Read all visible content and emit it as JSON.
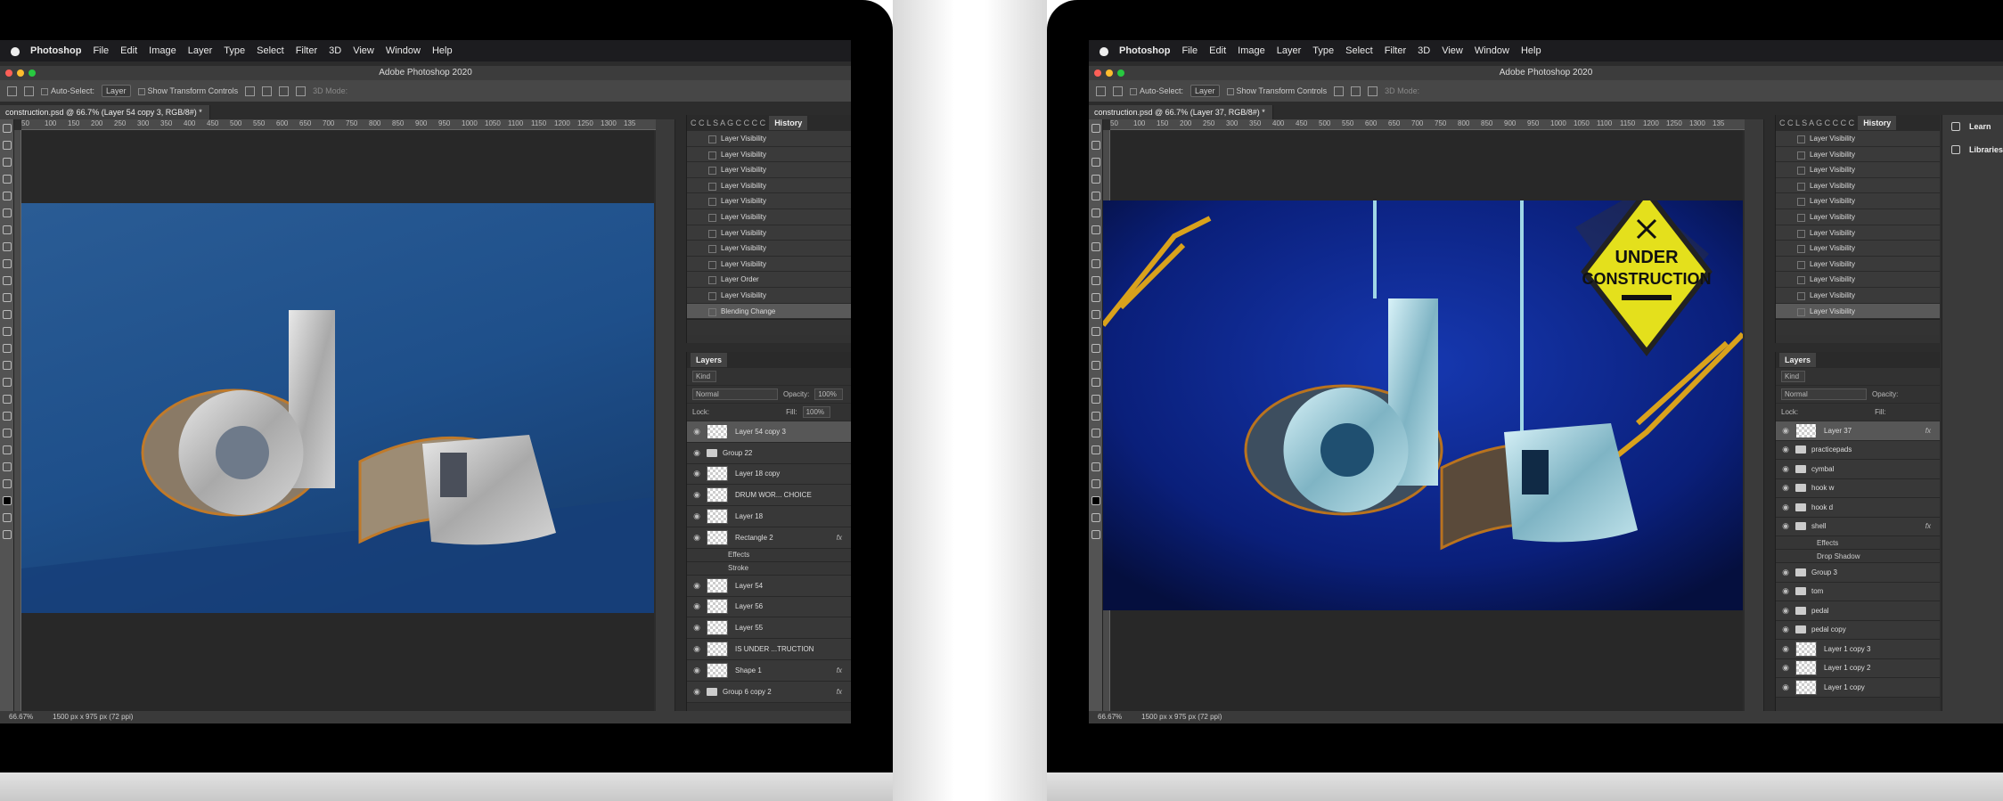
{
  "menubar": {
    "app": "Photoshop",
    "items": [
      "File",
      "Edit",
      "Image",
      "Layer",
      "Type",
      "Select",
      "Filter",
      "3D",
      "View",
      "Window",
      "Help"
    ]
  },
  "window_title": "Adobe Photoshop 2020",
  "options": {
    "auto_select": "Auto-Select:",
    "layer_dropdown": "Layer",
    "transform": "Show Transform Controls",
    "mode3d": "3D Mode:"
  },
  "left": {
    "tab": "construction.psd @ 66.7% (Layer 54 copy 3, RGB/8#) *",
    "ruler_ticks": [
      "50",
      "100",
      "150",
      "200",
      "250",
      "300",
      "350",
      "400",
      "450",
      "500",
      "550",
      "600",
      "650",
      "700",
      "750",
      "800",
      "850",
      "900",
      "950",
      "1000",
      "1050",
      "1100",
      "1150",
      "1200",
      "1250",
      "1300",
      "135"
    ],
    "panel_tabs": [
      "C",
      "C",
      "L",
      "S",
      "A",
      "G",
      "C",
      "C",
      "C",
      "C",
      "C"
    ],
    "history_tab": "History",
    "history": [
      "Layer Visibility",
      "Layer Visibility",
      "Layer Visibility",
      "Layer Visibility",
      "Layer Visibility",
      "Layer Visibility",
      "Layer Visibility",
      "Layer Visibility",
      "Layer Visibility",
      "Layer Order",
      "Layer Visibility",
      "Blending Change"
    ],
    "layers_tab": "Layers",
    "kind": "Kind",
    "blend": "Normal",
    "opacity_label": "Opacity:",
    "opacity": "100%",
    "lock_label": "Lock:",
    "fill_label": "Fill:",
    "fill": "100%",
    "layers": [
      "Layer 54 copy 3",
      "Group 22",
      "Layer 18 copy",
      "DRUM WOR... CHOICE",
      "Layer 18",
      "Rectangle 2",
      "Effects",
      "Stroke",
      "Layer 54",
      "Layer 56",
      "Layer 55",
      "IS UNDER ...TRUCTION",
      "Shape 1",
      "Group 6 copy 2"
    ],
    "fx": "fx",
    "zoom": "66.67%",
    "docsize": "1500 px x 975 px (72 ppi)"
  },
  "right": {
    "tab": "construction.psd @ 66.7% (Layer 37, RGB/8#) *",
    "history": [
      "Layer Visibility",
      "Layer Visibility",
      "Layer Visibility",
      "Layer Visibility",
      "Layer Visibility",
      "Layer Visibility",
      "Layer Visibility",
      "Layer Visibility",
      "Layer Visibility",
      "Layer Visibility",
      "Layer Visibility",
      "Layer Visibility"
    ],
    "layers": [
      "Layer 37",
      "practicepads",
      "cymbal",
      "hook w",
      "hook d",
      "shell",
      "Effects",
      "Drop Shadow",
      "Group 3",
      "tom",
      "pedal",
      "pedal copy",
      "Layer 1 copy 3",
      "Layer 1 copy 2",
      "Layer 1 copy"
    ],
    "sign_line1": "UNDER",
    "sign_line2": "CONSTRUCTION",
    "side": [
      "Learn",
      "Libraries"
    ],
    "zoom": "66.67%",
    "docsize": "1500 px x 975 px (72 ppi)"
  },
  "colors": {
    "left_bg": "#1e4f8a",
    "right_bg": "#0a1f7a",
    "sign_yellow": "#e4e01c"
  }
}
